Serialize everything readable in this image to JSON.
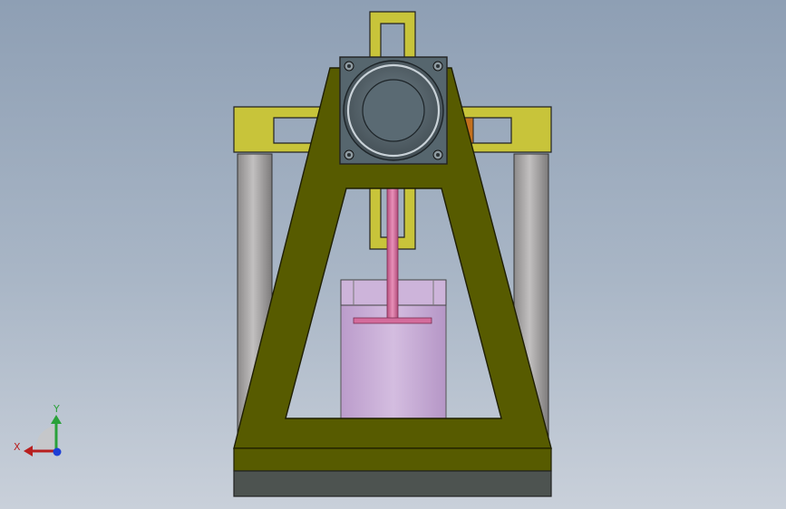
{
  "viewport": {
    "background_top": "#8e9fb4",
    "background_bottom": "#c9d0da"
  },
  "model": {
    "frame_color": "#575b00",
    "crossbar_color": "#c8c43a",
    "motor_color": "#5a6a73",
    "rod_color": "#d46c9c",
    "cylinder_color": "#c7acd6",
    "column_color": "#a8a6a6",
    "base_color": "#4d5350",
    "accent_color": "#c4701e"
  },
  "triad": {
    "x_label": "X",
    "y_label": "Y",
    "x_color": "#b81f1f",
    "y_color": "#2aa13a",
    "z_color": "#1d3fd6"
  }
}
